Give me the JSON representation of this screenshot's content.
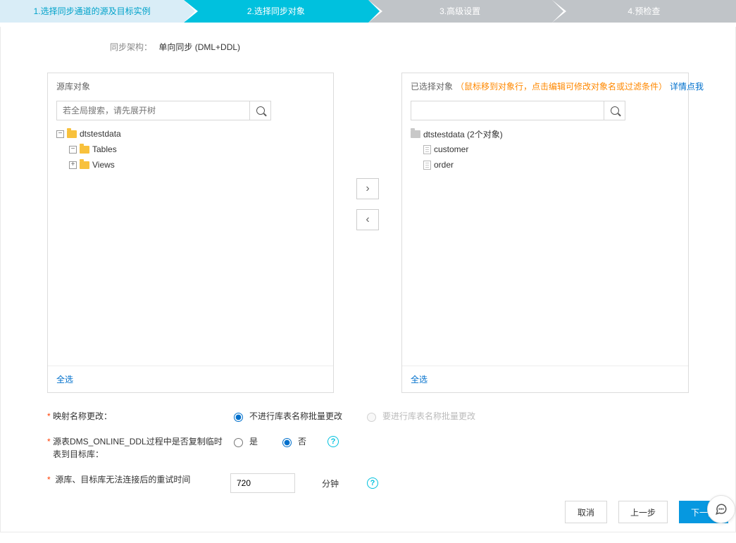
{
  "wizard": {
    "steps": [
      "1.选择同步通道的源及目标实例",
      "2.选择同步对象",
      "3.高级设置",
      "4.预检查"
    ]
  },
  "arch": {
    "label": "同步架构：",
    "value": "单向同步 (DML+DDL)"
  },
  "source_panel": {
    "title": "源库对象",
    "search_placeholder": "若全局搜索，请先展开树",
    "tree": {
      "db": "dtstestdata",
      "tables_label": "Tables",
      "views_label": "Views"
    },
    "select_all": "全选"
  },
  "target_panel": {
    "title": "已选择对象",
    "hint": "（鼠标移到对象行，点击编辑可修改对象名或过滤条件）",
    "details_link": "详情点我",
    "db_label": "dtstestdata (2个对象)",
    "items": [
      "customer",
      "order"
    ],
    "select_all": "全选"
  },
  "form": {
    "mapping": {
      "label": "映射名称更改：",
      "opt_no": "不进行库表名称批量更改",
      "opt_yes": "要进行库表名称批量更改"
    },
    "dms": {
      "label": "源表DMS_ONLINE_DDL过程中是否复制临时表到目标库：",
      "opt_yes": "是",
      "opt_no": "否"
    },
    "retry": {
      "label": "源库、目标库无法连接后的重试时间",
      "value": "720",
      "unit": "分钟"
    }
  },
  "footer": {
    "cancel": "取消",
    "prev": "上一步",
    "next": "下一步"
  }
}
